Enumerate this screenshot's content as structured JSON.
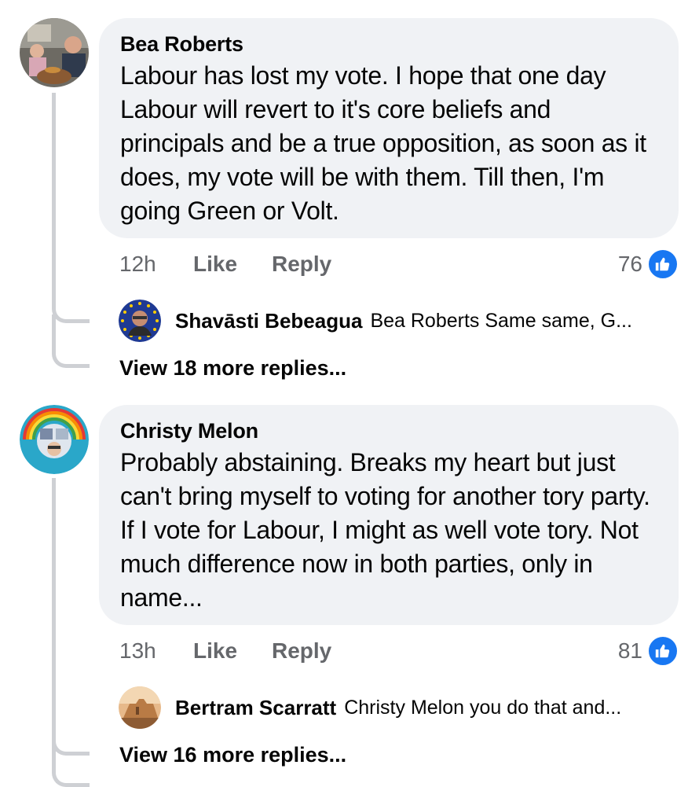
{
  "comments": [
    {
      "author": "Bea Roberts",
      "avatar_icon": "profile-photo",
      "text": "Labour has lost my vote. I hope that one day Labour will revert to it's core beliefs and principals and be a true opposition, as soon as it does, my vote will be with them. Till then, I'm going Green or Volt.",
      "time": "12h",
      "like_label": "Like",
      "reply_label": "Reply",
      "reaction_count": "76",
      "reaction_icon": "thumbs-up-icon",
      "reply_preview": {
        "author": "Shavāsti Bebeagua",
        "text": "Bea Roberts Same same, G..."
      },
      "view_more": "View 18 more replies..."
    },
    {
      "author": "Christy Melon",
      "avatar_icon": "profile-photo-covid-frame",
      "text": "Probably abstaining. Breaks my heart but just can't bring myself to voting for another tory party. If I vote for Labour, I might as well vote tory. Not much difference now in both parties, only in name...",
      "time": "13h",
      "like_label": "Like",
      "reply_label": "Reply",
      "reaction_count": "81",
      "reaction_icon": "thumbs-up-icon",
      "reply_preview": {
        "author": "Bertram Scarratt",
        "text": "Christy Melon you do that and..."
      },
      "view_more": "View 16 more replies..."
    }
  ],
  "colors": {
    "bubble": "#f0f2f5",
    "meta_text": "#65676b",
    "like_blue": "#1877f2",
    "connector": "#ced0d4"
  }
}
